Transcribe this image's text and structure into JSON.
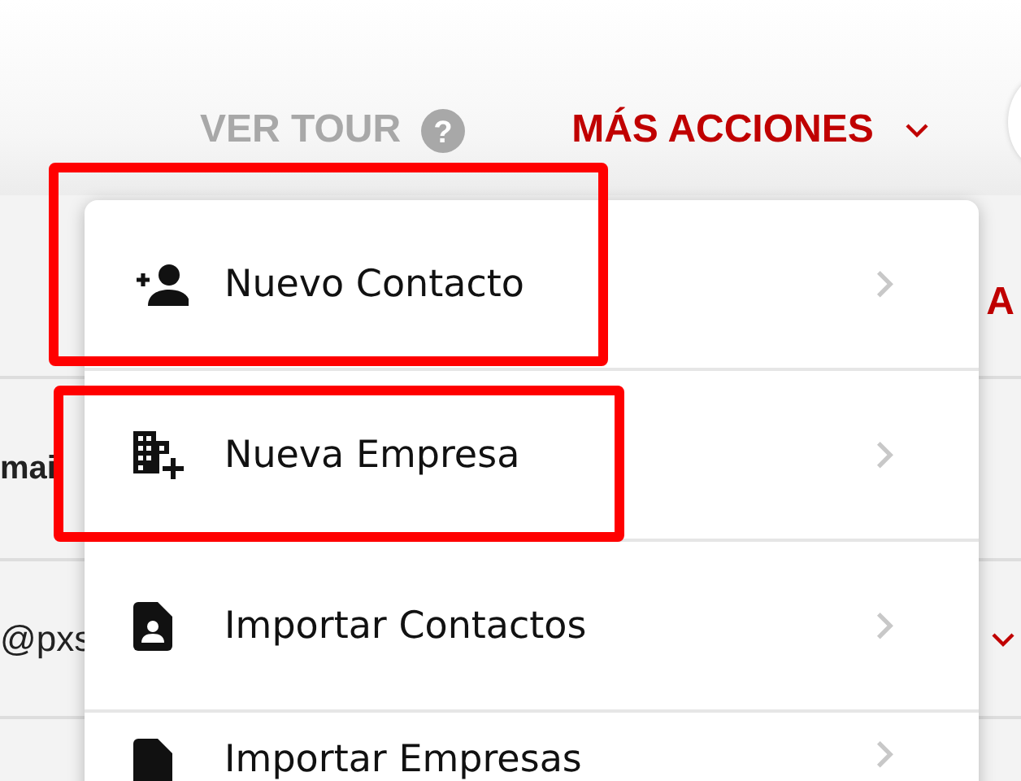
{
  "header": {
    "tour_label": "VER TOUR",
    "help_glyph": "?",
    "actions_label": "MÁS ACCIONES"
  },
  "background": {
    "button_fragment": "A",
    "column_fragment": "mai",
    "email_fragment": "@pxs"
  },
  "menu": {
    "items": [
      {
        "kind": "add-person",
        "label": "Nuevo Contacto",
        "highlighted": true
      },
      {
        "kind": "add-building",
        "label": "Nueva Empresa",
        "highlighted": true
      },
      {
        "kind": "person-file",
        "label": "Importar Contactos",
        "highlighted": false
      },
      {
        "kind": "file",
        "label": "Importar Empresas",
        "highlighted": false
      }
    ]
  }
}
